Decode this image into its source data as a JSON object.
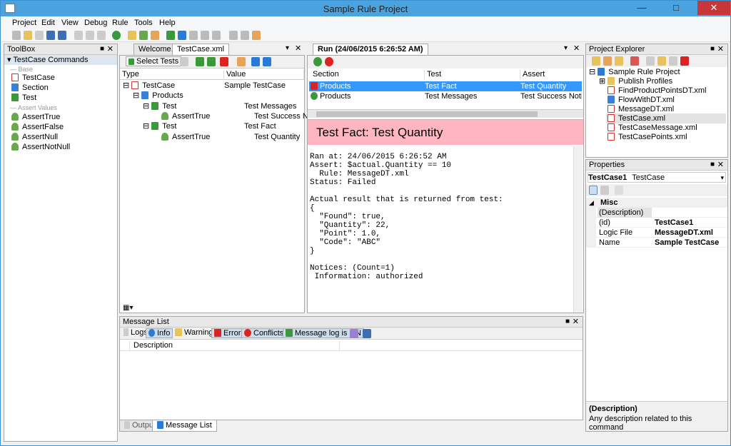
{
  "window": {
    "title": "Sample Rule Project"
  },
  "menu": [
    "Project",
    "Edit",
    "View",
    "Debug",
    "Rule",
    "Tools",
    "Help"
  ],
  "toolbox": {
    "title": "ToolBox",
    "group": "TestCase Commands",
    "section_base": "Base",
    "base_items": [
      "TestCase",
      "Section",
      "Test"
    ],
    "section_assert": "Assert Values",
    "assert_items": [
      "AssertTrue",
      "AssertFalse",
      "AssertNull",
      "AssertNotNull"
    ]
  },
  "editor": {
    "tabs": [
      "Welcome...",
      "TestCase.xml"
    ],
    "select_tests": "Select Tests",
    "col_type": "Type",
    "col_value": "Value",
    "rows": [
      {
        "type": "TestCase",
        "value": "Sample TestCase"
      },
      {
        "type": "Products",
        "value": ""
      },
      {
        "type": "Test",
        "value": "Test Messages"
      },
      {
        "type": "AssertTrue",
        "value": "Test Success Noti"
      },
      {
        "type": "Test",
        "value": "Test Fact"
      },
      {
        "type": "AssertTrue",
        "value": "Test Quantity"
      }
    ]
  },
  "run": {
    "tab": "Run (24/06/2015 6:26:52 AM)",
    "col_section": "Section",
    "col_test": "Test",
    "col_assert": "Assert",
    "results": [
      {
        "section": "Products",
        "test": "Test Fact",
        "assert": "Test Quantity",
        "status": "failed"
      },
      {
        "section": "Products",
        "test": "Test Messages",
        "assert": "Test Success Notificatio",
        "status": "passed"
      }
    ],
    "detail_title": "Test Fact: Test Quantity",
    "detail_lines": [
      "Ran at: 24/06/2015 6:26:52 AM",
      "Assert: $actual.Quantity == 10",
      "  Rule: MessageDT.xml",
      "Status: Failed",
      "",
      "Actual result that is returned from test:",
      "{",
      "  \"Found\": true,",
      "  \"Quantity\": 22,",
      "  \"Point\": 1.0,",
      "  \"Code\": \"ABC\"",
      "}",
      "",
      "Notices: (Count=1)",
      " Information: authorized"
    ]
  },
  "explorer": {
    "title": "Project Explorer",
    "root": "Sample Rule Project",
    "items": [
      "Publish Profiles",
      "FindProductPointsDT.xml",
      "FlowWithDT.xml",
      "MessageDT.xml",
      "TestCase.xml",
      "TestCaseMessage.xml",
      "TestCasePoints.xml"
    ]
  },
  "properties": {
    "title": "Properties",
    "object_name": "TestCase1",
    "object_type": "TestCase",
    "category": "Misc",
    "rows": [
      {
        "name": "(Description)",
        "value": ""
      },
      {
        "name": "(id)",
        "value": "TestCase1"
      },
      {
        "name": "Logic File",
        "value": "MessageDT.xml"
      },
      {
        "name": "Name",
        "value": "Sample TestCase"
      }
    ],
    "desc_title": "(Description)",
    "desc_text": "Any description related to this command"
  },
  "messages": {
    "title": "Message List",
    "buttons": [
      "Logs",
      "Info",
      "Warnings",
      "Errors",
      "Conflicts",
      "Message log is ON"
    ],
    "col_description": "Description",
    "bottom_tabs": [
      "Output",
      "Message List"
    ]
  }
}
